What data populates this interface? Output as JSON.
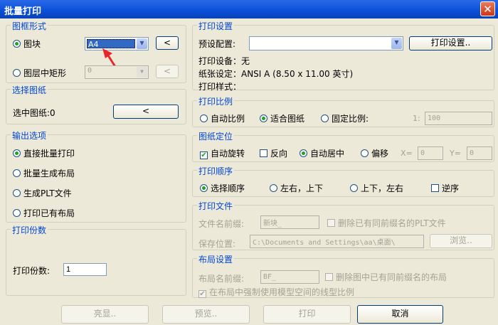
{
  "window": {
    "title": "批量打印",
    "close_glyph": "✕"
  },
  "frame_shape": {
    "title": "图框形式",
    "block_radio": "图块",
    "block_value": "A4",
    "block_pick_glyph": "<",
    "layer_rect_radio": "图层中矩形",
    "layer_rect_value": "0",
    "layer_rect_pick_glyph": "<"
  },
  "select_drawing": {
    "title": "选择图纸",
    "label": "选中图纸:0",
    "pick_glyph": "<"
  },
  "output_options": {
    "title": "输出选项",
    "items": [
      "直接批量打印",
      "批量生成布局",
      "生成PLT文件",
      "打印已有布局"
    ]
  },
  "copies": {
    "title": "打印份数",
    "label": "打印份数:",
    "value": "1"
  },
  "print_settings": {
    "title": "打印设置",
    "preset_label": "预设配置:",
    "preset_value": "",
    "settings_button": "打印设置..",
    "device": "打印设备：无",
    "paper": "纸张设定：ANSI A (8.50 x 11.00 英寸)",
    "style": "打印样式："
  },
  "print_scale": {
    "title": "打印比例",
    "auto": "自动比例",
    "fit": "适合图纸",
    "fixed": "固定比例:",
    "ratio_left": "1:",
    "ratio_value": "100"
  },
  "positioning": {
    "title": "图纸定位",
    "auto_rotate": "自动旋转",
    "reverse": "反向",
    "auto_center": "自动居中",
    "offset": "偏移",
    "x_label": "X=",
    "x_value": "0",
    "y_label": "Y=",
    "y_value": "0"
  },
  "print_order": {
    "title": "打印顺序",
    "selection": "选择顺序",
    "lr_tb": "左右，上下",
    "tb_lr": "上下，左右",
    "reverse": "逆序"
  },
  "print_file": {
    "title": "打印文件",
    "prefix_label": "文件名前缀:",
    "prefix_value": "新块_",
    "delete_plt": "删除已有同前缀名的PLT文件",
    "save_label": "保存位置:",
    "save_value": "C:\\Documents and Settings\\aa\\桌面\\",
    "browse_button": "浏览.."
  },
  "layout_settings": {
    "title": "布局设置",
    "prefix_label": "布局名前缀:",
    "prefix_value": "BF_",
    "delete_layout": "删除图中已有同前缀名的布局",
    "force_linetype": "在布局中强制使用模型空间的线型比例"
  },
  "bottom_buttons": {
    "highlight": "亮显..",
    "preview": "预览..",
    "print": "打印",
    "cancel": "取消"
  },
  "colors": {
    "title_bar": "#0a4fd7",
    "group_title": "#0046d5",
    "selection": "#316ac5",
    "annotation_arrow": "#e8262a"
  }
}
